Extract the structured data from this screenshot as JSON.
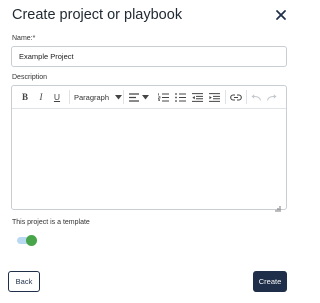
{
  "dialog": {
    "title": "Create project or playbook",
    "close_icon": "close-icon"
  },
  "form": {
    "name_label": "Name:*",
    "name_value": "Example Project",
    "description_label": "Description",
    "template_label": "This project is a template",
    "template_enabled": true
  },
  "editor": {
    "toolbar": {
      "bold": "B",
      "italic": "I",
      "underline": "U",
      "paragraph": "Paragraph",
      "icons": [
        "bold-icon",
        "italic-icon",
        "underline-icon",
        "chevron-down-icon",
        "align-left-icon",
        "ordered-list-icon",
        "bulleted-list-icon",
        "outdent-icon",
        "indent-icon",
        "link-icon",
        "undo-icon",
        "redo-icon"
      ]
    },
    "content": ""
  },
  "footer": {
    "back_label": "Back",
    "create_label": "Create"
  },
  "colors": {
    "primary": "#1f2f4a",
    "toggle_on": "#48a54a",
    "toggle_track": "#b9d8f2"
  }
}
